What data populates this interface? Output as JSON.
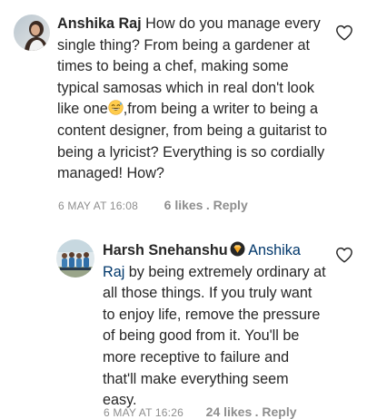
{
  "comment": {
    "username": "Anshika Raj",
    "text_before_emoji": "How do you manage every single thing? From being a gardener at times to being a chef, making some typical samosas which in real don't look like one",
    "emoji": "grinning-sweat-emoji",
    "text_after_emoji": ",from being a writer to being a content designer, from being a guitarist to being a lyricist? Everything is so cordially managed! How?",
    "date": "6 MAY AT 16:08",
    "likes": "6 likes",
    "reply_label": ". Reply"
  },
  "reply": {
    "username": "Harsh Snehanshu",
    "badge_icon": "verified-badge-icon",
    "mention": "Anshika Raj",
    "text": "by being extremely ordinary at all those things. If you truly want to enjoy life, remove the pressure of being good from it. You'll be more receptive to failure and that'll make everything seem easy.",
    "date": "6 MAY AT 16:26",
    "likes": "24 likes",
    "reply_label": ". Reply"
  },
  "colors": {
    "text": "#262626",
    "meta": "#8e8e8e",
    "mention": "#00376b",
    "badge": "#f5a623"
  },
  "icons": [
    "heart-outline-icon",
    "grinning-sweat-emoji",
    "verified-badge-icon"
  ]
}
